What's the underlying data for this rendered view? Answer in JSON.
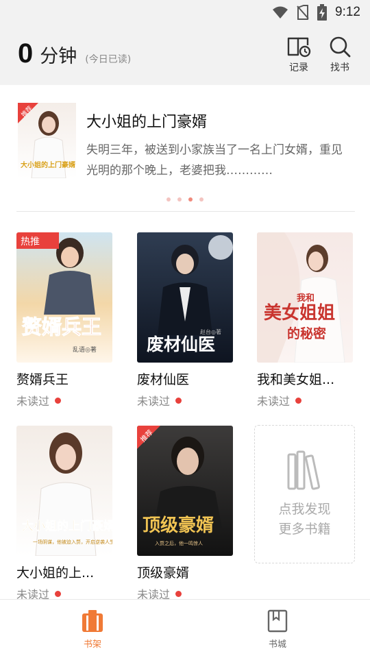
{
  "status_bar": {
    "time": "9:12",
    "icons": [
      "wifi-icon",
      "no-sim-icon",
      "battery-charging-icon"
    ]
  },
  "header": {
    "minutes": "0",
    "unit": "分钟",
    "sub": "(今日已读)",
    "history_label": "记录",
    "find_label": "找书"
  },
  "recommend": {
    "badge": "推荐",
    "title": "大小姐的上门豪婿",
    "desc": "失明三年，被送到小家族当了一名上门女婿，重见光明的那个晚上，老婆把我…………",
    "cover_text": "大小姐的上门豪婿",
    "dots": 4,
    "active_dot": 3
  },
  "books": [
    {
      "name": "赘婿兵王",
      "state": "未读过",
      "badge": "热推",
      "cover_text": "赘婿兵王",
      "cover_sub": "乱语◎著"
    },
    {
      "name": "废材仙医",
      "state": "未读过",
      "cover_text": "废材仙医",
      "cover_sub": "赵台◎著"
    },
    {
      "name": "我和美女姐...",
      "state": "未读过",
      "cover_text": "美女姐姐",
      "cover_text2": "我和",
      "cover_text3": "的秘密"
    },
    {
      "name": "大小姐的上...",
      "state": "未读过",
      "cover_text": "大小姐的上门豪婿",
      "cover_sub": "一场阴谋，他被迫入赘，开启逆袭人生"
    },
    {
      "name": "顶级豪婿",
      "state": "未读过",
      "badge": "推荐",
      "cover_text": "顶级豪婿",
      "cover_sub": "入赘之后，他一鸣惊人"
    }
  ],
  "more": {
    "line1": "点我发现",
    "line2": "更多书籍"
  },
  "nav": {
    "shelf": "书架",
    "store": "书城"
  },
  "colors": {
    "accent": "#f07a36",
    "unread_dot": "#e8413c",
    "header_bg": "#f2f2f2"
  }
}
